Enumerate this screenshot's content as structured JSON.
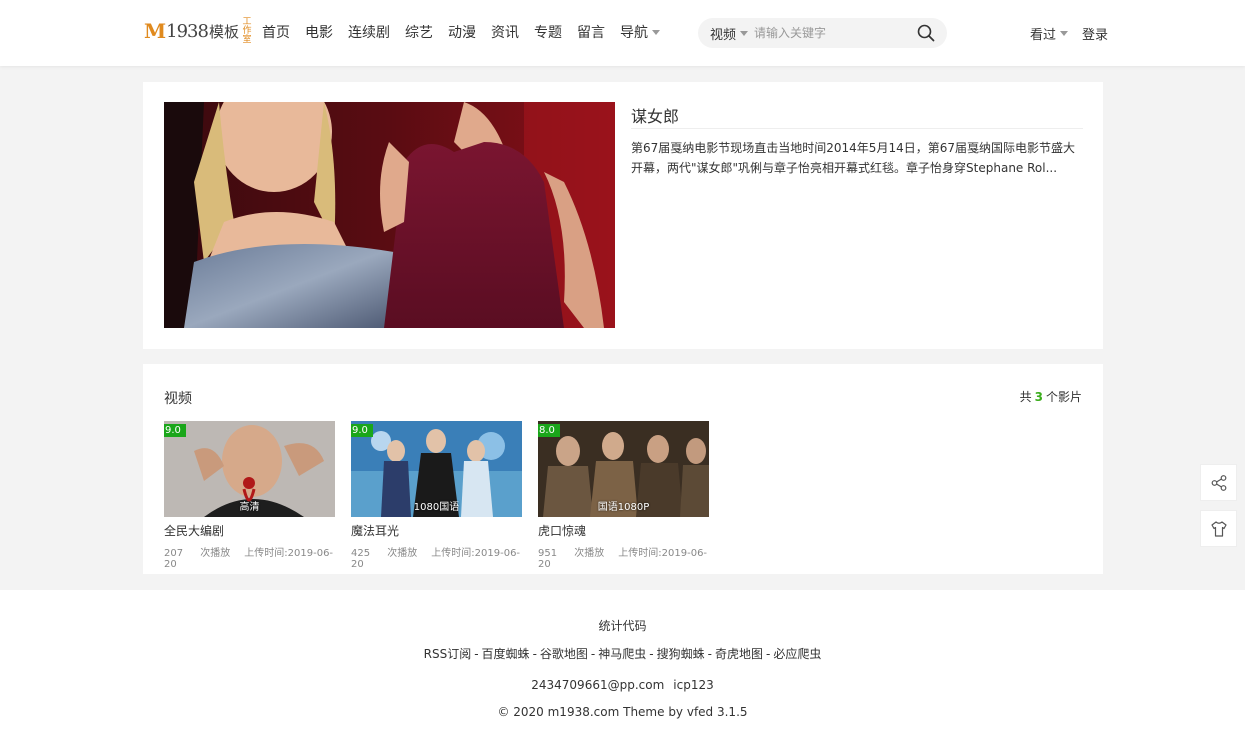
{
  "header": {
    "logo": {
      "m": "M",
      "num": "1938",
      "cn": "模板",
      "stamp": "工作室"
    },
    "nav": [
      "首页",
      "电影",
      "连续剧",
      "综艺",
      "动漫",
      "资讯",
      "专题",
      "留言",
      "导航"
    ],
    "search": {
      "type": "视频",
      "placeholder": "请输入关键字"
    },
    "history_label": "看过",
    "login_label": "登录"
  },
  "detail": {
    "title": "谋女郎",
    "description": "第67届戛纳电影节现场直击当地时间2014年5月14日，第67届戛纳国际电影节盛大开幕，两代\"谋女郎\"巩俐与章子怡亮相开幕式红毯。章子怡身穿Stephane Rol..."
  },
  "videos": {
    "section_title": "视频",
    "count_prefix": "共",
    "count": "3",
    "count_suffix": "个影片",
    "items": [
      {
        "score": "9.0",
        "quality": "高清",
        "title": "全民大编剧",
        "plays": "207",
        "plays_suffix": "次播放",
        "upload": "上传时间:2019-06-20"
      },
      {
        "score": "9.0",
        "quality": "1080国语",
        "title": "魔法耳光",
        "plays": "425",
        "plays_suffix": "次播放",
        "upload": "上传时间:2019-06-20"
      },
      {
        "score": "8.0",
        "quality": "国语1080P",
        "title": "虎口惊魂",
        "plays": "951",
        "plays_suffix": "次播放",
        "upload": "上传时间:2019-06-20"
      }
    ]
  },
  "footer": {
    "stat": "统计代码",
    "links": [
      "RSS订阅",
      "百度蜘蛛",
      "谷歌地图",
      "神马爬虫",
      "搜狗蜘蛛",
      "奇虎地图",
      "必应爬虫"
    ],
    "link_sep": "-",
    "email": "2434709661@pp.com",
    "icp": "icp123",
    "copyright": "© 2020 m1938.com Theme by vfed 3.1.5"
  },
  "colors": {
    "accent": "#e08a1e",
    "score_badge": "#1aa61a",
    "count": "#3bad1c"
  }
}
